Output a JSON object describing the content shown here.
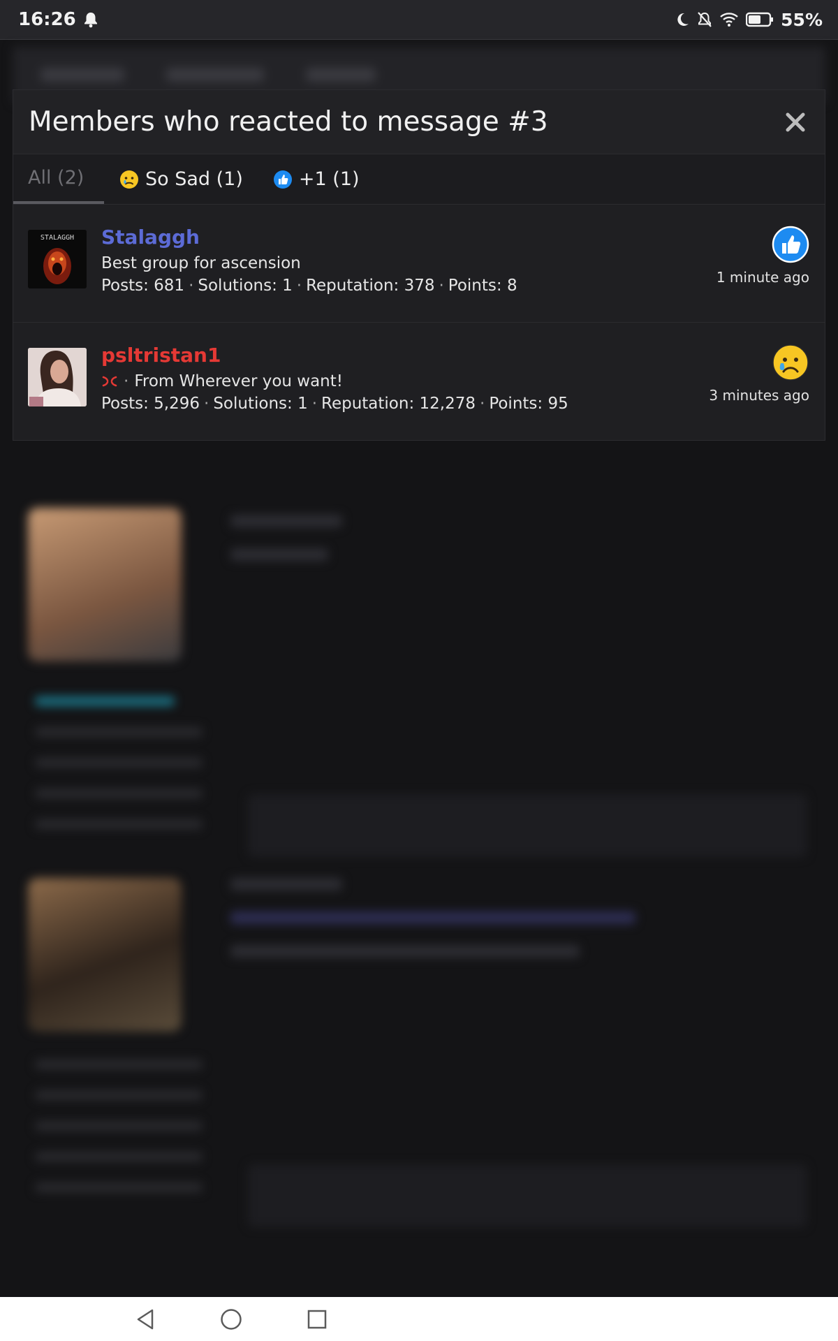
{
  "status_bar": {
    "time": "16:26",
    "battery": "55%",
    "icons": [
      "notification-bell-icon",
      "do-not-disturb-moon-icon",
      "muted-bell-icon",
      "wifi-icon",
      "battery-icon"
    ]
  },
  "modal": {
    "title": "Members who reacted to message #3",
    "tabs": [
      {
        "label": "All (2)",
        "active": true
      },
      {
        "label": "So Sad (1)",
        "icon": "sad-face-icon"
      },
      {
        "label": "+1 (1)",
        "icon": "thumbs-up-icon"
      }
    ],
    "members": [
      {
        "username": "Stalaggh",
        "username_color": "#5c6bd6",
        "avatar_text": "STALAGGH",
        "title": "Best group for ascension",
        "title_icon": null,
        "stats": {
          "posts": "Posts: 681",
          "solutions": "Solutions: 1",
          "reputation": "Reputation: 378",
          "points": "Points: 8"
        },
        "reaction": "thumbs-up-icon",
        "time": "1 minute ago"
      },
      {
        "username": "psltristan1",
        "username_color": "#e53935",
        "title": "From Wherever you want!",
        "title_icon": "anger-symbol-icon",
        "stats": {
          "posts": "Posts: 5,296",
          "solutions": "Solutions: 1",
          "reputation": "Reputation: 12,278",
          "points": "Points: 95"
        },
        "reaction": "sad-face-icon",
        "time": "3 minutes ago"
      }
    ]
  },
  "colors": {
    "accent_blue": "#1d8bf1",
    "sad_yellow": "#f7c623"
  }
}
